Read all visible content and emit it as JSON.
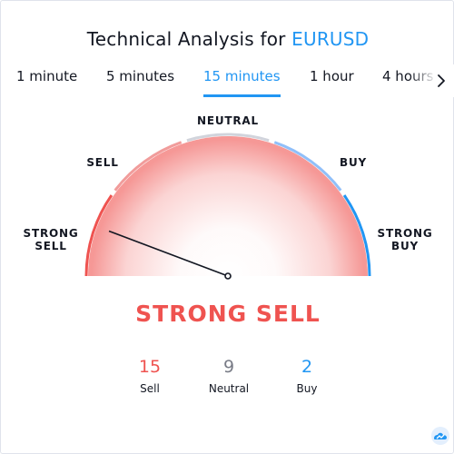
{
  "title": {
    "prefix": "Technical Analysis for ",
    "symbol": "EURUSD"
  },
  "tabs": [
    {
      "label": "1 minute",
      "active": false
    },
    {
      "label": "5 minutes",
      "active": false
    },
    {
      "label": "15 minutes",
      "active": true
    },
    {
      "label": "1 hour",
      "active": false
    },
    {
      "label": "4 hours",
      "active": false
    }
  ],
  "gauge": {
    "labels": {
      "strong_sell": [
        "STRONG",
        "SELL"
      ],
      "sell": "SELL",
      "neutral": "NEUTRAL",
      "buy": "BUY",
      "strong_buy": [
        "STRONG",
        "BUY"
      ]
    },
    "needle_value": -0.77
  },
  "summary": "STRONG SELL",
  "counters": [
    {
      "value": "15",
      "label": "Sell",
      "color": "#ef5350"
    },
    {
      "value": "9",
      "label": "Neutral",
      "color": "#787b86"
    },
    {
      "value": "2",
      "label": "Buy",
      "color": "#2196f3"
    }
  ],
  "colors": {
    "accent": "#2196f3",
    "strong_sell": "#ef5350",
    "sell": "#f19c9b",
    "neutral": "#d1d4dc",
    "buy": "#90bff9",
    "strong_buy": "#2196f3"
  },
  "icons": {
    "tabs_arrow": "chevron-right-icon",
    "logo": "tradingview-logo-icon"
  }
}
